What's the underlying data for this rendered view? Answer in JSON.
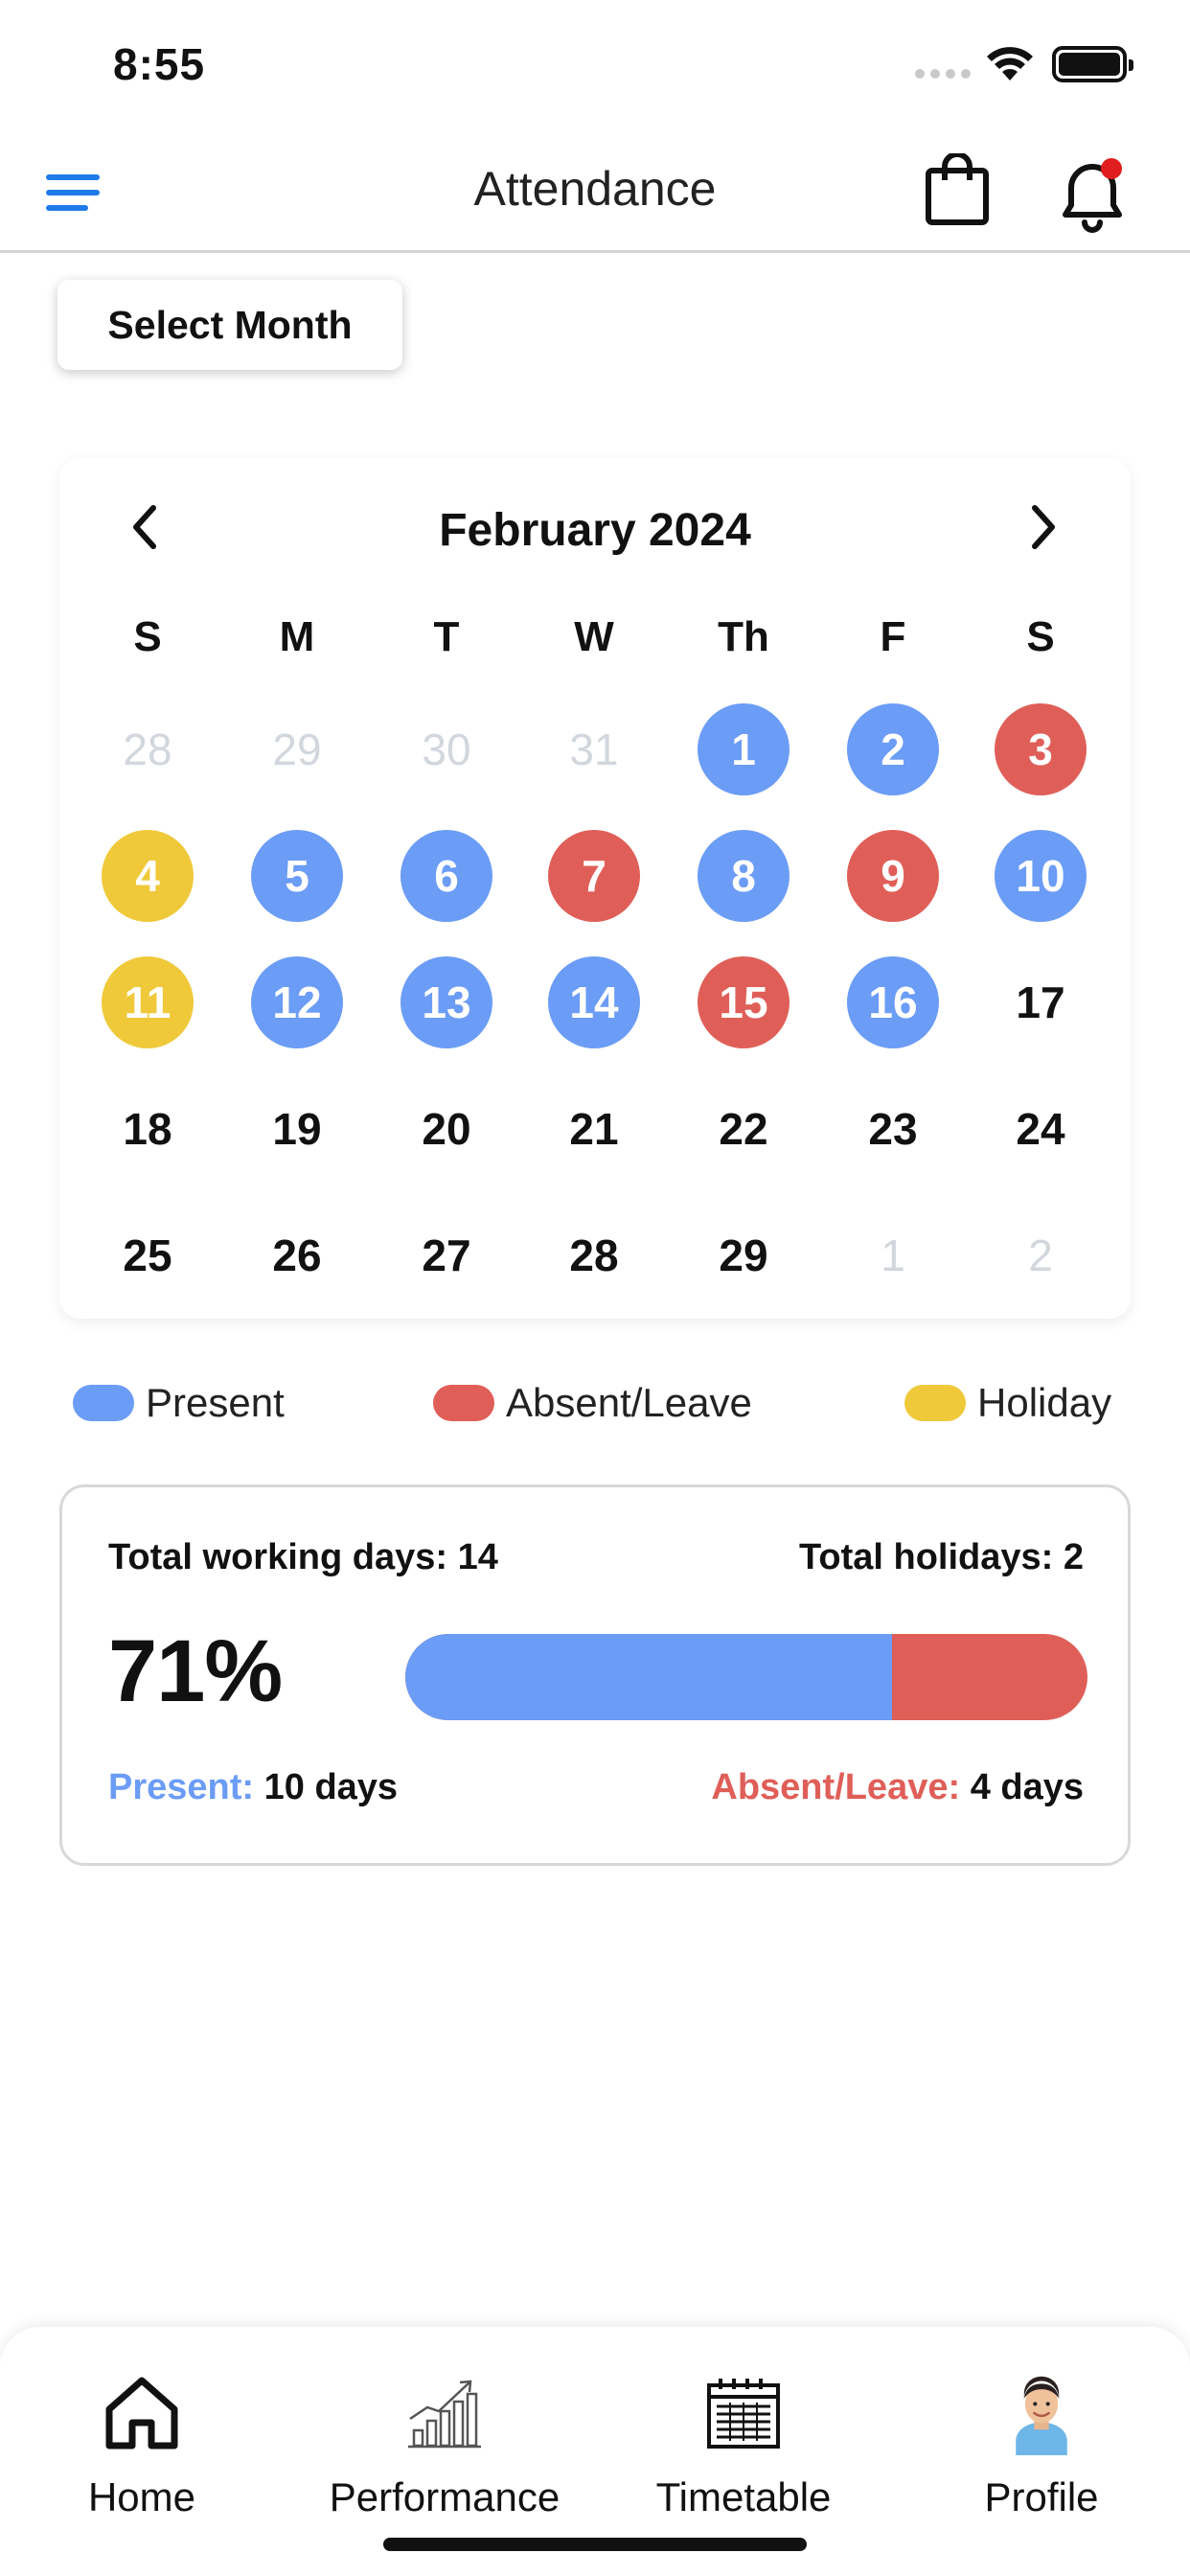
{
  "status_bar": {
    "time": "8:55"
  },
  "header": {
    "title": "Attendance",
    "menu_icon": "hamburger-menu-icon",
    "cart_icon": "shopping-bag-icon",
    "notification_icon": "bell-icon"
  },
  "select_month": {
    "label": "Select Month"
  },
  "calendar": {
    "title": "February 2024",
    "weekdays": [
      "S",
      "M",
      "T",
      "W",
      "Th",
      "F",
      "S"
    ],
    "rows": [
      [
        {
          "d": "28",
          "s": "muted"
        },
        {
          "d": "29",
          "s": "muted"
        },
        {
          "d": "30",
          "s": "muted"
        },
        {
          "d": "31",
          "s": "muted"
        },
        {
          "d": "1",
          "s": "present"
        },
        {
          "d": "2",
          "s": "present"
        },
        {
          "d": "3",
          "s": "absent"
        }
      ],
      [
        {
          "d": "4",
          "s": "holiday"
        },
        {
          "d": "5",
          "s": "present"
        },
        {
          "d": "6",
          "s": "present"
        },
        {
          "d": "7",
          "s": "absent"
        },
        {
          "d": "8",
          "s": "present"
        },
        {
          "d": "9",
          "s": "absent"
        },
        {
          "d": "10",
          "s": "present"
        }
      ],
      [
        {
          "d": "11",
          "s": "holiday"
        },
        {
          "d": "12",
          "s": "present"
        },
        {
          "d": "13",
          "s": "present"
        },
        {
          "d": "14",
          "s": "present"
        },
        {
          "d": "15",
          "s": "absent"
        },
        {
          "d": "16",
          "s": "present"
        },
        {
          "d": "17",
          "s": "normal"
        }
      ],
      [
        {
          "d": "18",
          "s": "normal"
        },
        {
          "d": "19",
          "s": "normal"
        },
        {
          "d": "20",
          "s": "normal"
        },
        {
          "d": "21",
          "s": "normal"
        },
        {
          "d": "22",
          "s": "normal"
        },
        {
          "d": "23",
          "s": "normal"
        },
        {
          "d": "24",
          "s": "normal"
        }
      ],
      [
        {
          "d": "25",
          "s": "normal"
        },
        {
          "d": "26",
          "s": "normal"
        },
        {
          "d": "27",
          "s": "normal"
        },
        {
          "d": "28",
          "s": "normal"
        },
        {
          "d": "29",
          "s": "normal"
        },
        {
          "d": "1",
          "s": "muted"
        },
        {
          "d": "2",
          "s": "muted"
        }
      ]
    ]
  },
  "legend": {
    "present": {
      "label": "Present",
      "color": "#6b9cf6"
    },
    "absent": {
      "label": "Absent/Leave",
      "color": "#df5f58"
    },
    "holiday": {
      "label": "Holiday",
      "color": "#efc93a"
    }
  },
  "stats": {
    "total_working_days": "Total working days: 14",
    "total_holidays": "Total holidays: 2",
    "percent": "71%",
    "present_fraction": 0.714,
    "present_label": "Present:",
    "present_value": "10 days",
    "absent_label": "Absent/Leave:",
    "absent_value": "4 days"
  },
  "nav": [
    {
      "label": "Home",
      "icon": "home-icon"
    },
    {
      "label": "Performance",
      "icon": "growth-chart-icon"
    },
    {
      "label": "Timetable",
      "icon": "calendar-grid-icon"
    },
    {
      "label": "Profile",
      "icon": "avatar"
    }
  ]
}
